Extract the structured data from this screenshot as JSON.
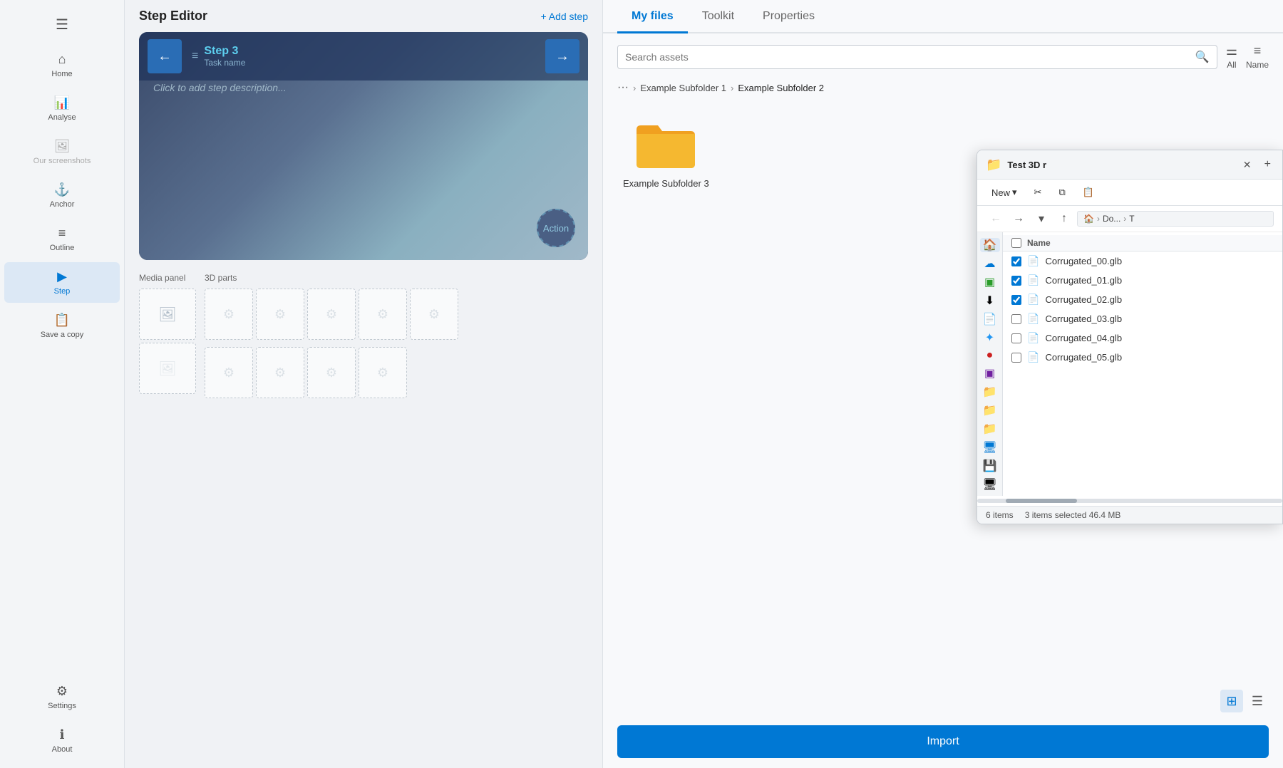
{
  "sidebar": {
    "menu_icon": "☰",
    "items": [
      {
        "id": "home",
        "label": "Home",
        "icon": "⌂",
        "active": false
      },
      {
        "id": "analyse",
        "label": "Analyse",
        "icon": "📊",
        "active": false
      },
      {
        "id": "our-screenshots",
        "label": "Our screenshots",
        "icon": "🖼",
        "active": false,
        "disabled": true
      },
      {
        "id": "anchor",
        "label": "Anchor",
        "icon": "⚓",
        "active": false
      },
      {
        "id": "outline",
        "label": "Outline",
        "icon": "☰",
        "active": false
      },
      {
        "id": "step",
        "label": "Step",
        "icon": "▶",
        "active": true
      },
      {
        "id": "save-copy",
        "label": "Save a copy",
        "icon": "📋",
        "active": false
      }
    ],
    "bottom_items": [
      {
        "id": "settings",
        "label": "Settings",
        "icon": "⚙"
      },
      {
        "id": "about",
        "label": "About",
        "icon": "ℹ"
      }
    ]
  },
  "step_editor": {
    "title": "Step Editor",
    "add_step_label": "+ Add step",
    "step": {
      "number": "Step 3",
      "task_label": "Task name",
      "description_placeholder": "Click to add step description...",
      "action_label": "Action"
    },
    "panels": {
      "media_label": "Media panel",
      "parts_label": "3D parts"
    }
  },
  "right_panel": {
    "tabs": [
      {
        "id": "my-files",
        "label": "My files",
        "active": true
      },
      {
        "id": "toolkit",
        "label": "Toolkit",
        "active": false
      },
      {
        "id": "properties",
        "label": "Properties",
        "active": false
      }
    ],
    "search": {
      "placeholder": "Search assets",
      "filter_label": "All",
      "sort_label": "Name"
    },
    "breadcrumb": {
      "dots": "···",
      "items": [
        "Example Subfolder 1",
        "Example Subfolder 2"
      ]
    },
    "folder": {
      "name": "Example Subfolder 3"
    },
    "import_label": "Import",
    "view_grid": "⊞",
    "view_list": "☰"
  },
  "file_explorer": {
    "title": "Test 3D r",
    "toolbar": {
      "new_label": "New",
      "cut_icon": "✂",
      "copy_icon": "⧉",
      "paste_icon": "📋"
    },
    "nav": {
      "path_parts": [
        "Do...",
        "T"
      ]
    },
    "header": {
      "name_col": "Name"
    },
    "files": [
      {
        "name": "Corrugated_00.glb",
        "checked": true
      },
      {
        "name": "Corrugated_01.glb",
        "checked": true
      },
      {
        "name": "Corrugated_02.glb",
        "checked": true
      },
      {
        "name": "Corrugated_03.glb",
        "checked": false
      },
      {
        "name": "Corrugated_04.glb",
        "checked": false
      },
      {
        "name": "Corrugated_05.glb",
        "checked": false
      }
    ],
    "status": {
      "item_count": "6 items",
      "selected_info": "3 items selected  46.4 MB"
    }
  }
}
